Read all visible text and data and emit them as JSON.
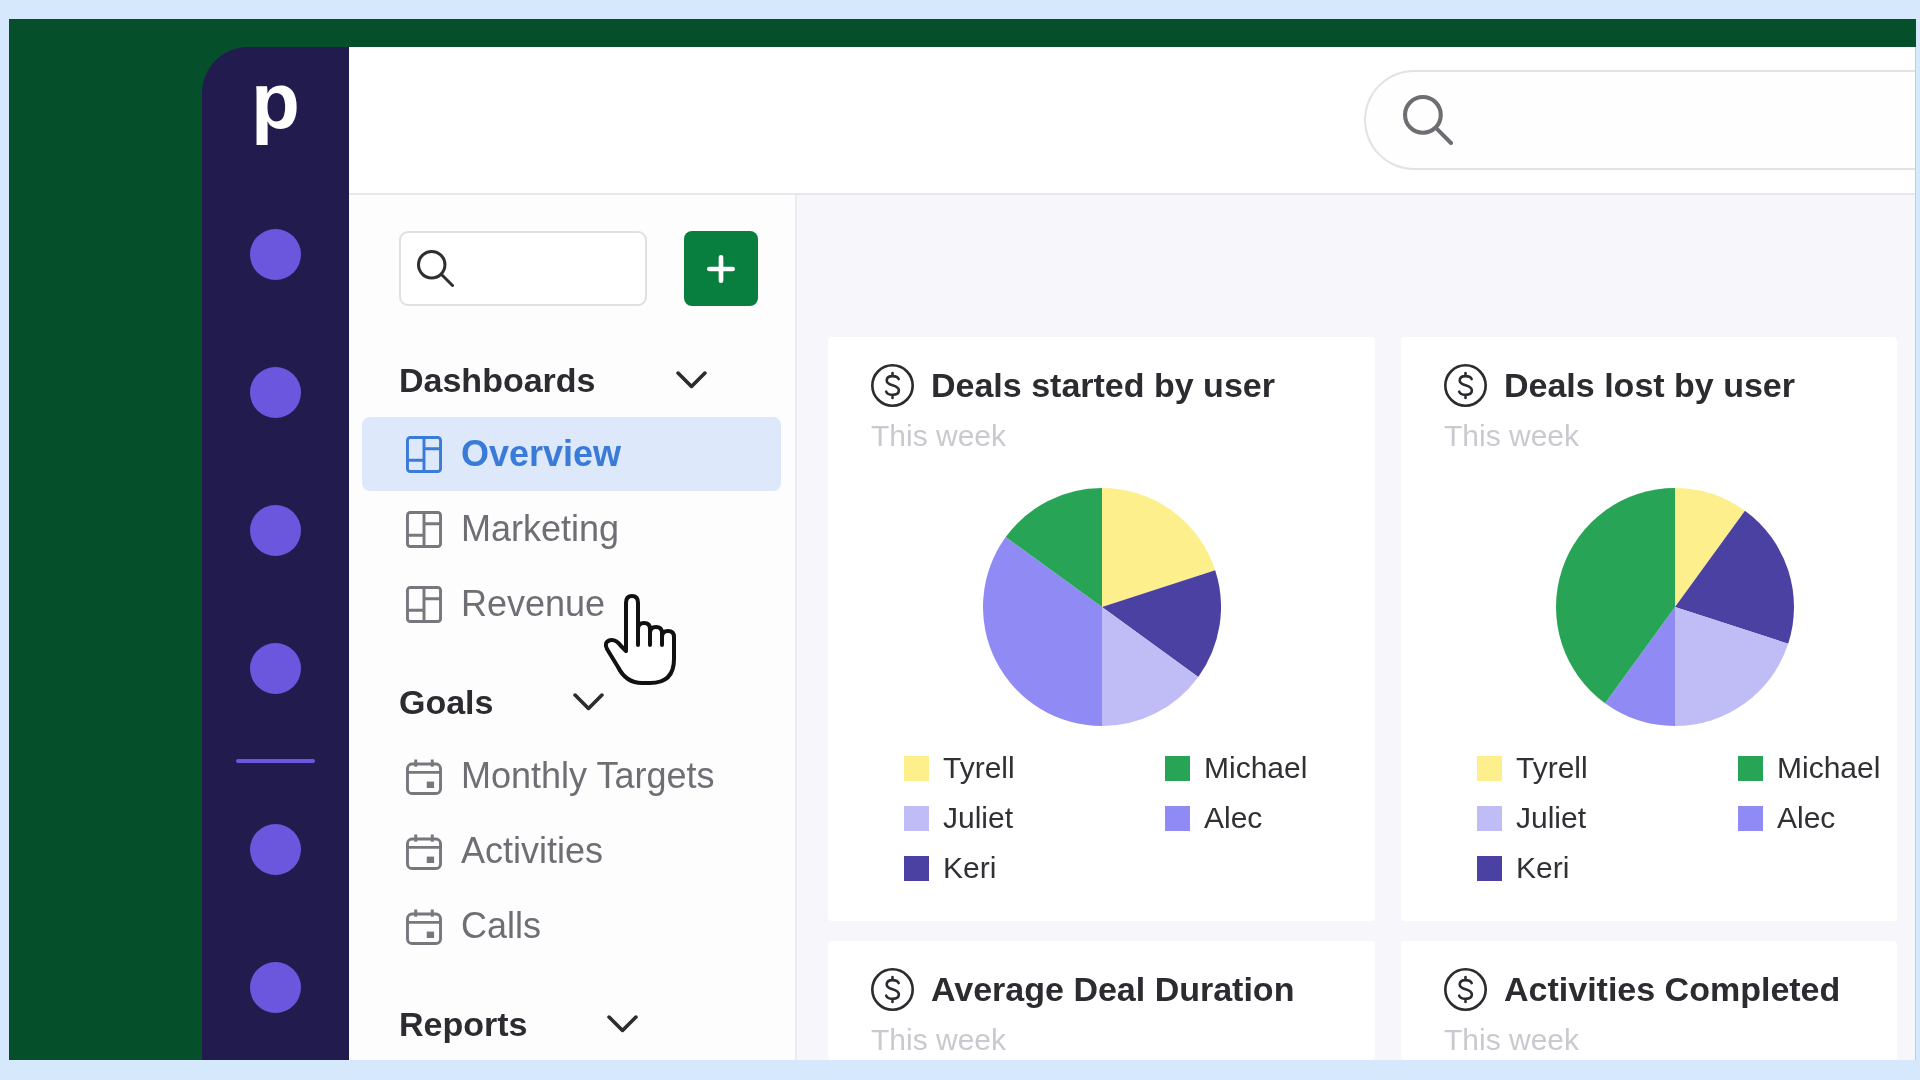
{
  "sidebar": {
    "logo": "p"
  },
  "nav": {
    "sections": [
      {
        "title": "Dashboards",
        "expanded": true,
        "items": [
          {
            "label": "Overview",
            "kind": "dashboard",
            "selected": true
          },
          {
            "label": "Marketing",
            "kind": "dashboard",
            "selected": false
          },
          {
            "label": "Revenue",
            "kind": "dashboard",
            "selected": false
          }
        ]
      },
      {
        "title": "Goals",
        "expanded": true,
        "items": [
          {
            "label": "Monthly Targets",
            "kind": "goal",
            "selected": false
          },
          {
            "label": "Activities",
            "kind": "goal",
            "selected": false
          },
          {
            "label": "Calls",
            "kind": "goal",
            "selected": false
          }
        ]
      },
      {
        "title": "Reports",
        "expanded": true
      }
    ]
  },
  "cards": [
    {
      "title": "Deals started by user",
      "subtitle": "This week",
      "slices": [
        {
          "color": "#fdf08c"
        },
        {
          "color": "#4a41a3"
        },
        {
          "color": "#c0bcf6"
        },
        {
          "color": "#8f8af4"
        },
        {
          "color": "#27a456"
        }
      ],
      "chart_data": {
        "type": "pie",
        "categories": [
          "Tyrell",
          "Keri",
          "Juliet",
          "Alec",
          "Michael"
        ],
        "values": [
          20,
          15,
          15,
          35,
          15
        ],
        "legend": "bottom"
      }
    },
    {
      "title": "Deals lost by user",
      "subtitle": "This week",
      "slices": [
        {
          "color": "#fdf08c"
        },
        {
          "color": "#4a41a3"
        },
        {
          "color": "#c0bcf6"
        },
        {
          "color": "#8f8af4"
        },
        {
          "color": "#27a456"
        }
      ],
      "chart_data": {
        "type": "pie",
        "categories": [
          "Tyrell",
          "Keri",
          "Juliet",
          "Alec",
          "Michael"
        ],
        "values": [
          10,
          20,
          20,
          10,
          40
        ],
        "legend": "bottom"
      }
    },
    {
      "title": "Average Deal Duration",
      "subtitle": "This week"
    },
    {
      "title": "Activities Completed",
      "subtitle": "This week"
    }
  ]
}
